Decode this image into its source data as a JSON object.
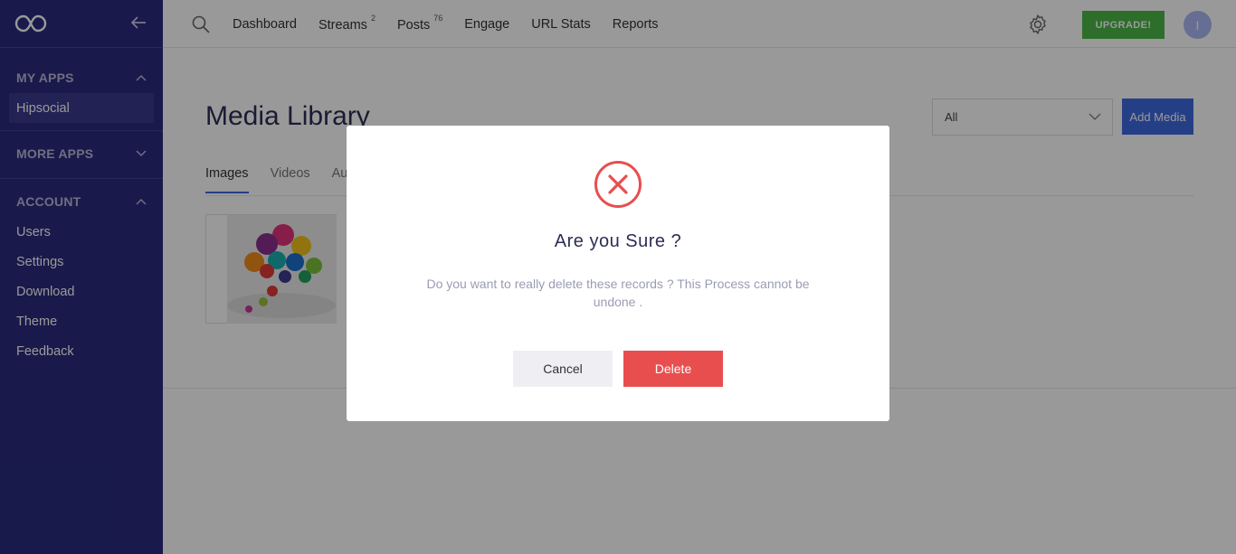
{
  "sidebar": {
    "sections": [
      {
        "title": "MY APPS",
        "items": [
          "Hipsocial"
        ]
      },
      {
        "title": "MORE APPS",
        "items": []
      },
      {
        "title": "ACCOUNT",
        "items": [
          "Users",
          "Settings",
          "Download",
          "Theme",
          "Feedback"
        ]
      }
    ]
  },
  "topbar": {
    "nav": [
      {
        "label": "Dashboard",
        "badge": ""
      },
      {
        "label": "Streams",
        "badge": "2"
      },
      {
        "label": "Posts",
        "badge": "76"
      },
      {
        "label": "Engage",
        "badge": ""
      },
      {
        "label": "URL Stats",
        "badge": ""
      },
      {
        "label": "Reports",
        "badge": ""
      }
    ],
    "upgrade_label": "UPGRADE!",
    "avatar_initial": "I"
  },
  "main": {
    "title": "Media Library",
    "filter_value": "All",
    "add_media_label": "Add Media",
    "tabs": [
      "Images",
      "Videos",
      "Au"
    ]
  },
  "modal": {
    "title": "Are you Sure ?",
    "message": "Do you want to really delete these records ? This Process cannot be undone .",
    "cancel_label": "Cancel",
    "delete_label": "Delete"
  },
  "colors": {
    "sidebar_bg": "#2a2b7e",
    "upgrade_green": "#4cb848",
    "primary_blue": "#3e6ae1",
    "danger_red": "#e94e4e"
  },
  "icons": {
    "logo": "infinity-logo-icon",
    "collapse": "arrow-left-icon",
    "search": "search-icon",
    "settings": "gear-icon",
    "dialog": "error-x-circle-icon"
  }
}
